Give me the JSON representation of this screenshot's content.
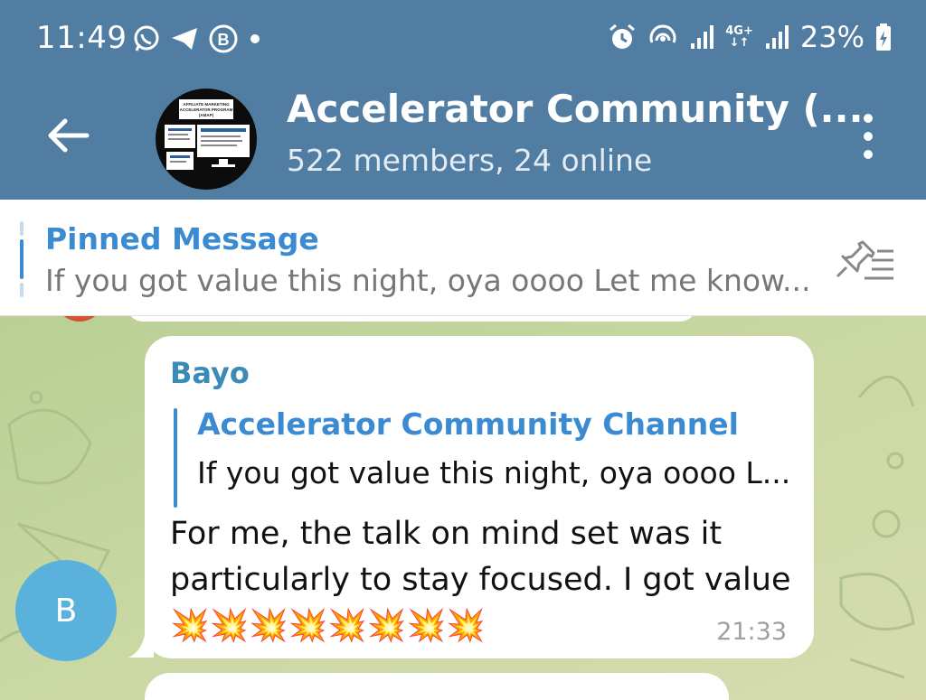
{
  "status_bar": {
    "time": "11:49",
    "network": "4G+",
    "battery": "23%"
  },
  "header": {
    "title": "Accelerator Community (...",
    "subtitle": "522 members, 24 online",
    "avatar_lines": [
      "AFFILIATE MARKETING",
      "ACCELERATOR PROGRAM",
      "(AMAP)"
    ]
  },
  "pinned": {
    "title": "Pinned Message",
    "text": "If you got value this night, oya oooo  Let me know..."
  },
  "message": {
    "sender": "Bayo",
    "reply_title": "Accelerator Community Channel",
    "reply_text": "If you got value this night, oya oooo  L...",
    "text": "For me, the talk on mind set was it particularly to stay focused. I got value 💥💥💥💥💥💥💥💥",
    "time": "21:33",
    "avatar_letter": "B"
  },
  "colors": {
    "header": "#517DA2",
    "accent": "#3a8bd2",
    "chat_bg": "#c8d6a1",
    "avatar_bg": "#5ab2dc"
  }
}
